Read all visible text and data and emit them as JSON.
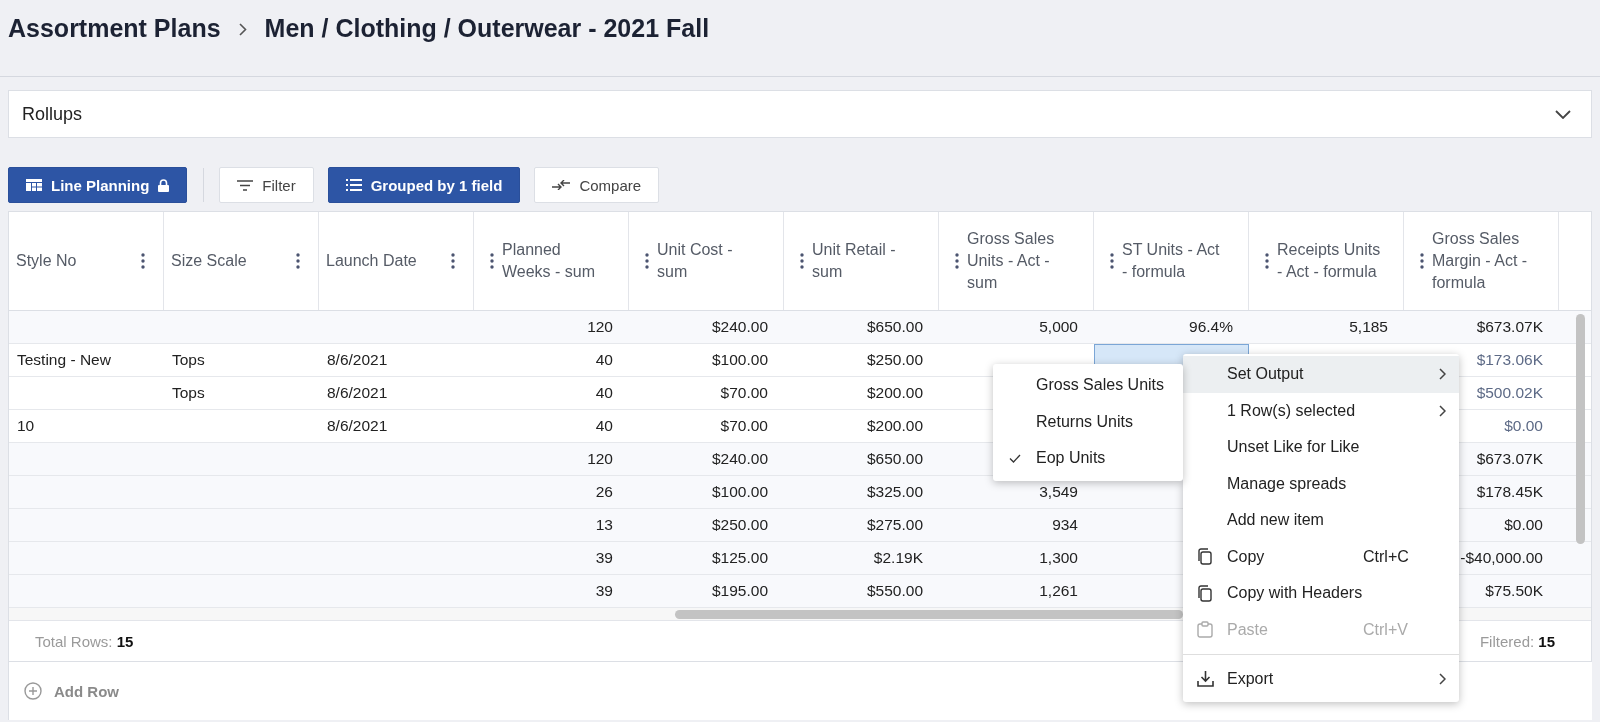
{
  "breadcrumb": [
    {
      "label": "Assortment Plans"
    },
    {
      "label": "Men / Clothing / Outerwear - 2021 Fall"
    }
  ],
  "rollups": {
    "label": "Rollups",
    "expanded": false
  },
  "toolbar": [
    {
      "label": "Line Planning",
      "kind": "primary",
      "locked": true
    },
    {
      "label": "Filter",
      "kind": "secondary",
      "locked": false
    },
    {
      "label": "Grouped by 1 field",
      "kind": "primary",
      "locked": false
    },
    {
      "label": "Compare",
      "kind": "secondary",
      "locked": false
    }
  ],
  "table": {
    "columns": [
      {
        "label": "Style No"
      },
      {
        "label": "Size Scale"
      },
      {
        "label": "Launch Date"
      },
      {
        "label": "Planned Weeks - sum"
      },
      {
        "label": "Unit Cost - sum"
      },
      {
        "label": "Unit Retail - sum"
      },
      {
        "label": "Gross Sales Units - Act - sum"
      },
      {
        "label": "ST Units - Act - formula"
      },
      {
        "label": "Receipts Units - Act - formula"
      },
      {
        "label": "Gross Sales Margin - Act - formula"
      }
    ],
    "rows": [
      {
        "group": true,
        "cells": [
          null,
          null,
          null,
          "120",
          "$240.00",
          "$650.00",
          "5,000",
          "96.4%",
          "5,185",
          "$673.07K"
        ]
      },
      {
        "group": false,
        "cells": [
          "Testing - New",
          "Tops",
          "8/6/2021",
          "40",
          "$100.00",
          "$250.00",
          null,
          {
            "selected": true
          },
          null,
          "$173.06K"
        ]
      },
      {
        "group": false,
        "cells": [
          null,
          "Tops",
          "8/6/2021",
          "40",
          "$70.00",
          "$200.00",
          null,
          null,
          null,
          "$500.02K"
        ]
      },
      {
        "group": false,
        "cells": [
          "10",
          null,
          "8/6/2021",
          "40",
          "$70.00",
          "$200.00",
          null,
          null,
          null,
          "$0.00"
        ]
      },
      {
        "group": true,
        "cells": [
          null,
          null,
          null,
          "120",
          "$240.00",
          "$650.00",
          null,
          null,
          null,
          "$673.07K"
        ]
      },
      {
        "group": true,
        "cells": [
          null,
          null,
          null,
          "26",
          "$100.00",
          "$325.00",
          "3,549",
          null,
          null,
          "$178.45K"
        ]
      },
      {
        "group": true,
        "cells": [
          null,
          null,
          null,
          "13",
          "$250.00",
          "$275.00",
          "934",
          null,
          null,
          "$0.00"
        ]
      },
      {
        "group": true,
        "cells": [
          null,
          null,
          null,
          "39",
          "$125.00",
          "$2.19K",
          "1,300",
          null,
          null,
          "-$40,000.00"
        ]
      },
      {
        "group": true,
        "cells": [
          null,
          null,
          null,
          "39",
          "$195.00",
          "$550.00",
          "1,261",
          null,
          null,
          "$75.50K"
        ]
      }
    ],
    "total_rows": {
      "label": "Total Rows:",
      "value": "15"
    },
    "filtered": {
      "label": "Filtered:",
      "value": "15"
    }
  },
  "add_row": {
    "label": "Add Row"
  },
  "context_menu": {
    "items": [
      {
        "kind": "item",
        "label": "Set Output",
        "submenu": true,
        "selected": true,
        "disabled": false
      },
      {
        "kind": "item",
        "label": "1 Row(s) selected",
        "submenu": true,
        "selected": false,
        "disabled": false
      },
      {
        "kind": "item",
        "label": "Unset Like for Like",
        "submenu": false,
        "selected": false,
        "disabled": false
      },
      {
        "kind": "item",
        "label": "Manage spreads",
        "submenu": false,
        "selected": false,
        "disabled": false
      },
      {
        "kind": "item",
        "label": "Add new item",
        "submenu": false,
        "selected": false,
        "disabled": false
      },
      {
        "kind": "item",
        "label": "Copy",
        "shortcut": "Ctrl+C",
        "submenu": false,
        "selected": false,
        "disabled": false
      },
      {
        "kind": "item",
        "label": "Copy with Headers",
        "submenu": false,
        "selected": false,
        "disabled": false
      },
      {
        "kind": "item",
        "label": "Paste",
        "shortcut": "Ctrl+V",
        "submenu": false,
        "selected": false,
        "disabled": true
      },
      {
        "kind": "divider"
      },
      {
        "kind": "item",
        "label": "Export",
        "submenu": true,
        "selected": false,
        "disabled": false
      }
    ],
    "submenu": [
      {
        "label": "Gross Sales Units",
        "checked": false
      },
      {
        "label": "Returns Units",
        "checked": false
      },
      {
        "label": "Eop Units",
        "checked": true
      }
    ]
  }
}
